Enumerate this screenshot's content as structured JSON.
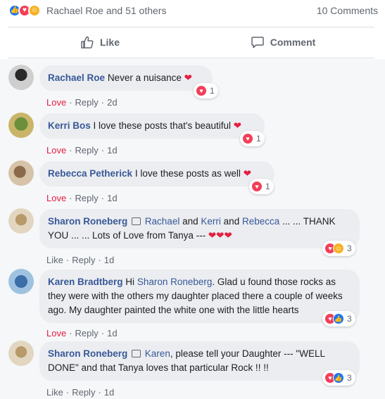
{
  "summary": {
    "reaction_icons": [
      "like-icon",
      "love-icon",
      "care-icon"
    ],
    "names_text": "Rachael Roe and 51 others",
    "comments_text": "10 Comments"
  },
  "actions": {
    "like_label": "Like",
    "comment_label": "Comment"
  },
  "colors": {
    "link": "#385898",
    "love": "#e41e3f",
    "muted": "#606770",
    "bubble": "#ebedf0",
    "like_blue": "#1877f2"
  },
  "comments": [
    {
      "author": "Rachael Roe",
      "text": "Never a nuisance",
      "reaction_label": "Love",
      "reply_label": "Reply",
      "time": "2d",
      "reaction_count": "1"
    },
    {
      "author": "Kerri Bos",
      "text": "I love these posts that's beautiful",
      "reaction_label": "Love",
      "reply_label": "Reply",
      "time": "1d",
      "reaction_count": "1"
    },
    {
      "author": "Rebecca Petherick",
      "text": "I love these posts as well",
      "reaction_label": "Love",
      "reply_label": "Reply",
      "time": "1d",
      "reaction_count": "1"
    },
    {
      "author": "Sharon Roneberg",
      "mentions": [
        "Rachael",
        "Kerri",
        "Rebecca"
      ],
      "text_and": "and",
      "text_after": "... ... THANK YOU ... ... Lots of Love from Tanya ---",
      "reaction_label": "Like",
      "reply_label": "Reply",
      "time": "1d",
      "reaction_count": "3"
    },
    {
      "author": "Karen Bradtberg",
      "text_before": "Hi",
      "mention": "Sharon Roneberg",
      "text_after": ". Glad u found those rocks as they were with the others my daughter placed there a couple of weeks ago. My daughter painted the white one with the little hearts",
      "reaction_label": "Love",
      "reply_label": "Reply",
      "time": "1d",
      "reaction_count": "3"
    },
    {
      "author": "Sharon Roneberg",
      "mention": "Karen",
      "text_after": ", please tell your Daughter --- \"WELL DONE\" and that Tanya loves that particular Rock !! !!",
      "reaction_label": "Like",
      "reply_label": "Reply",
      "time": "1d",
      "reaction_count": "3"
    }
  ]
}
